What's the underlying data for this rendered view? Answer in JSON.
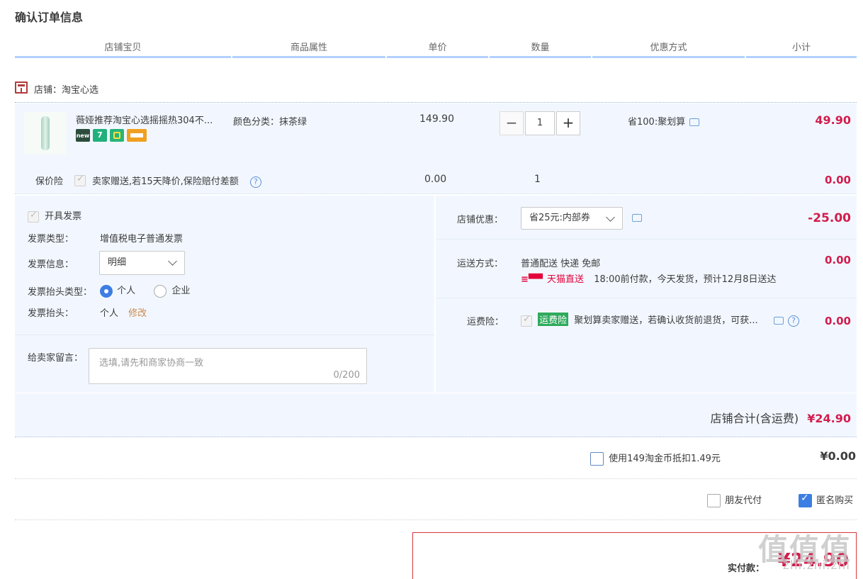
{
  "page_title": "确认订单信息",
  "columns": [
    "店铺宝贝",
    "商品属性",
    "单价",
    "数量",
    "优惠方式",
    "小计"
  ],
  "store": {
    "label": "店铺：淘宝心选"
  },
  "item": {
    "name": "薇娅推荐淘宝心选摇摇热304不...",
    "spec": "颜色分类：抹茶绿",
    "price": "149.90",
    "quantity": "1",
    "promo": "省100:聚划算",
    "subtotal": "49.90",
    "badges": [
      "new-badge",
      "7-day-return-badge",
      "tmall-badge",
      "card-badge"
    ],
    "minus": "−",
    "plus": "+"
  },
  "insurance": {
    "label": "保价险",
    "text": "卖家赠送,若15天降价,保险赔付差额",
    "price": "0.00",
    "quantity": "1",
    "subtotal": "0.00"
  },
  "invoice": {
    "toggle_label": "开具发票",
    "type_label": "发票类型：",
    "type_value": "增值税电子普通发票",
    "info_label": "发票信息：",
    "info_value": "明细",
    "header_type_label": "发票抬头类型：",
    "option_personal": "个人",
    "option_company": "企业",
    "header_label": "发票抬头：",
    "header_value": "个人",
    "edit_link": "修改"
  },
  "message": {
    "label": "给卖家留言：",
    "placeholder": "选填,请先和商家协商一致",
    "counter": "0/200"
  },
  "store_discount": {
    "label": "店铺优惠：",
    "value": "省25元:内部券",
    "amount": "-25.00"
  },
  "shipping": {
    "label": "运送方式：",
    "method": "普通配送 快递 免邮",
    "tmall_direct": "天猫直送",
    "eta": "18:00前付款，今天发货，预计12月8日送达",
    "amount": "0.00"
  },
  "freight_insurance": {
    "label": "运费险：",
    "badge": "运费险",
    "text": "聚划算卖家赠送，若确认收货前退货，可获...",
    "amount": "0.00"
  },
  "store_total": {
    "label": "店铺合计(含运费)",
    "amount": "¥24.90"
  },
  "coins": {
    "label": "使用149淘金币抵扣1.49元",
    "amount": "¥0.00"
  },
  "options": {
    "friend_pay": "朋友代付",
    "anonymous": "匿名购买"
  },
  "payment": {
    "label": "实付款：",
    "amount": "¥24.90"
  },
  "watermark": {
    "main": "值值值",
    "sub": "zhi.zhi.zhi"
  },
  "colors": {
    "accent_red": "#d21d4d",
    "panel_bg": "#f2f7ff",
    "header_line": "#b2d1ff",
    "checkbox_blue": "#3d7ee3"
  }
}
